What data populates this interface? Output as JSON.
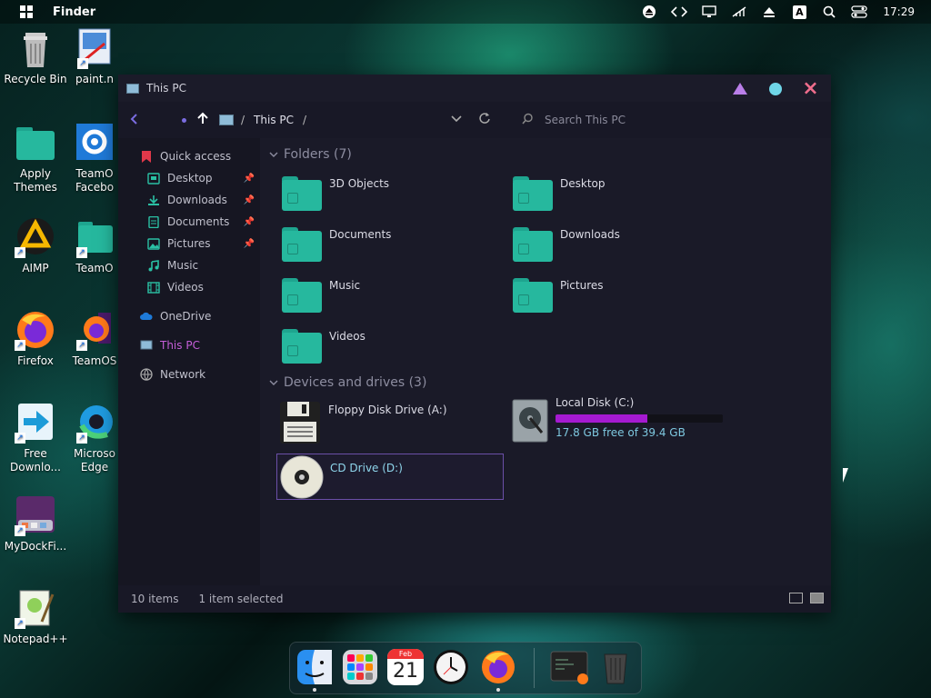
{
  "topbar": {
    "app_name": "Finder",
    "icons": [
      "eject-icon",
      "code-icon",
      "monitor-icon",
      "network-off-icon",
      "upload-icon",
      "keyboard-layout-icon",
      "search-icon",
      "toggle-icon"
    ],
    "keyboard_letter": "A",
    "clock": "17:29"
  },
  "desktop": {
    "icons": [
      {
        "name": "recycle-bin",
        "label": "Recycle Bin"
      },
      {
        "name": "paint",
        "label": "paint.n"
      },
      {
        "name": "apply-themes",
        "label": "Apply Themes"
      },
      {
        "name": "teamos-facebook",
        "label": "TeamO Facebo"
      },
      {
        "name": "aimp",
        "label": "AIMP"
      },
      {
        "name": "teamos",
        "label": "TeamO"
      },
      {
        "name": "firefox",
        "label": "Firefox"
      },
      {
        "name": "teamos-firefox",
        "label": "TeamOS"
      },
      {
        "name": "free-download",
        "label": "Free Downlo..."
      },
      {
        "name": "edge",
        "label": "Microso Edge"
      },
      {
        "name": "mydock",
        "label": "MyDockFi..."
      },
      {
        "name": "notepad",
        "label": "Notepad++"
      }
    ]
  },
  "window": {
    "title": "This PC",
    "breadcrumb": [
      "This PC"
    ],
    "separator": "/",
    "search_placeholder": "Search This PC",
    "accent": "#c55ed8"
  },
  "sidebar": {
    "quick_access": "Quick access",
    "items": [
      {
        "label": "Desktop",
        "pinned": true
      },
      {
        "label": "Downloads",
        "pinned": true
      },
      {
        "label": "Documents",
        "pinned": true
      },
      {
        "label": "Pictures",
        "pinned": true
      },
      {
        "label": "Music",
        "pinned": false
      },
      {
        "label": "Videos",
        "pinned": false
      }
    ],
    "onedrive": "OneDrive",
    "this_pc": "This PC",
    "network": "Network"
  },
  "content": {
    "folders_header": "Folders (7)",
    "folders": [
      "3D Objects",
      "Desktop",
      "Documents",
      "Downloads",
      "Music",
      "Pictures",
      "Videos"
    ],
    "devices_header": "Devices and drives (3)",
    "drives": [
      {
        "name": "Floppy Disk Drive (A:)"
      },
      {
        "name": "Local Disk (C:)",
        "free": "17.8 GB free of 39.4 GB",
        "used_fraction": 0.55
      },
      {
        "name": "CD Drive (D:)"
      }
    ]
  },
  "status": {
    "count": "10 items",
    "selected": "1 item selected"
  },
  "dock": {
    "items": [
      "finder",
      "launchpad",
      "calendar",
      "clock",
      "firefox",
      "terminal",
      "trash"
    ],
    "calendar_month": "Feb",
    "calendar_day": "21"
  }
}
